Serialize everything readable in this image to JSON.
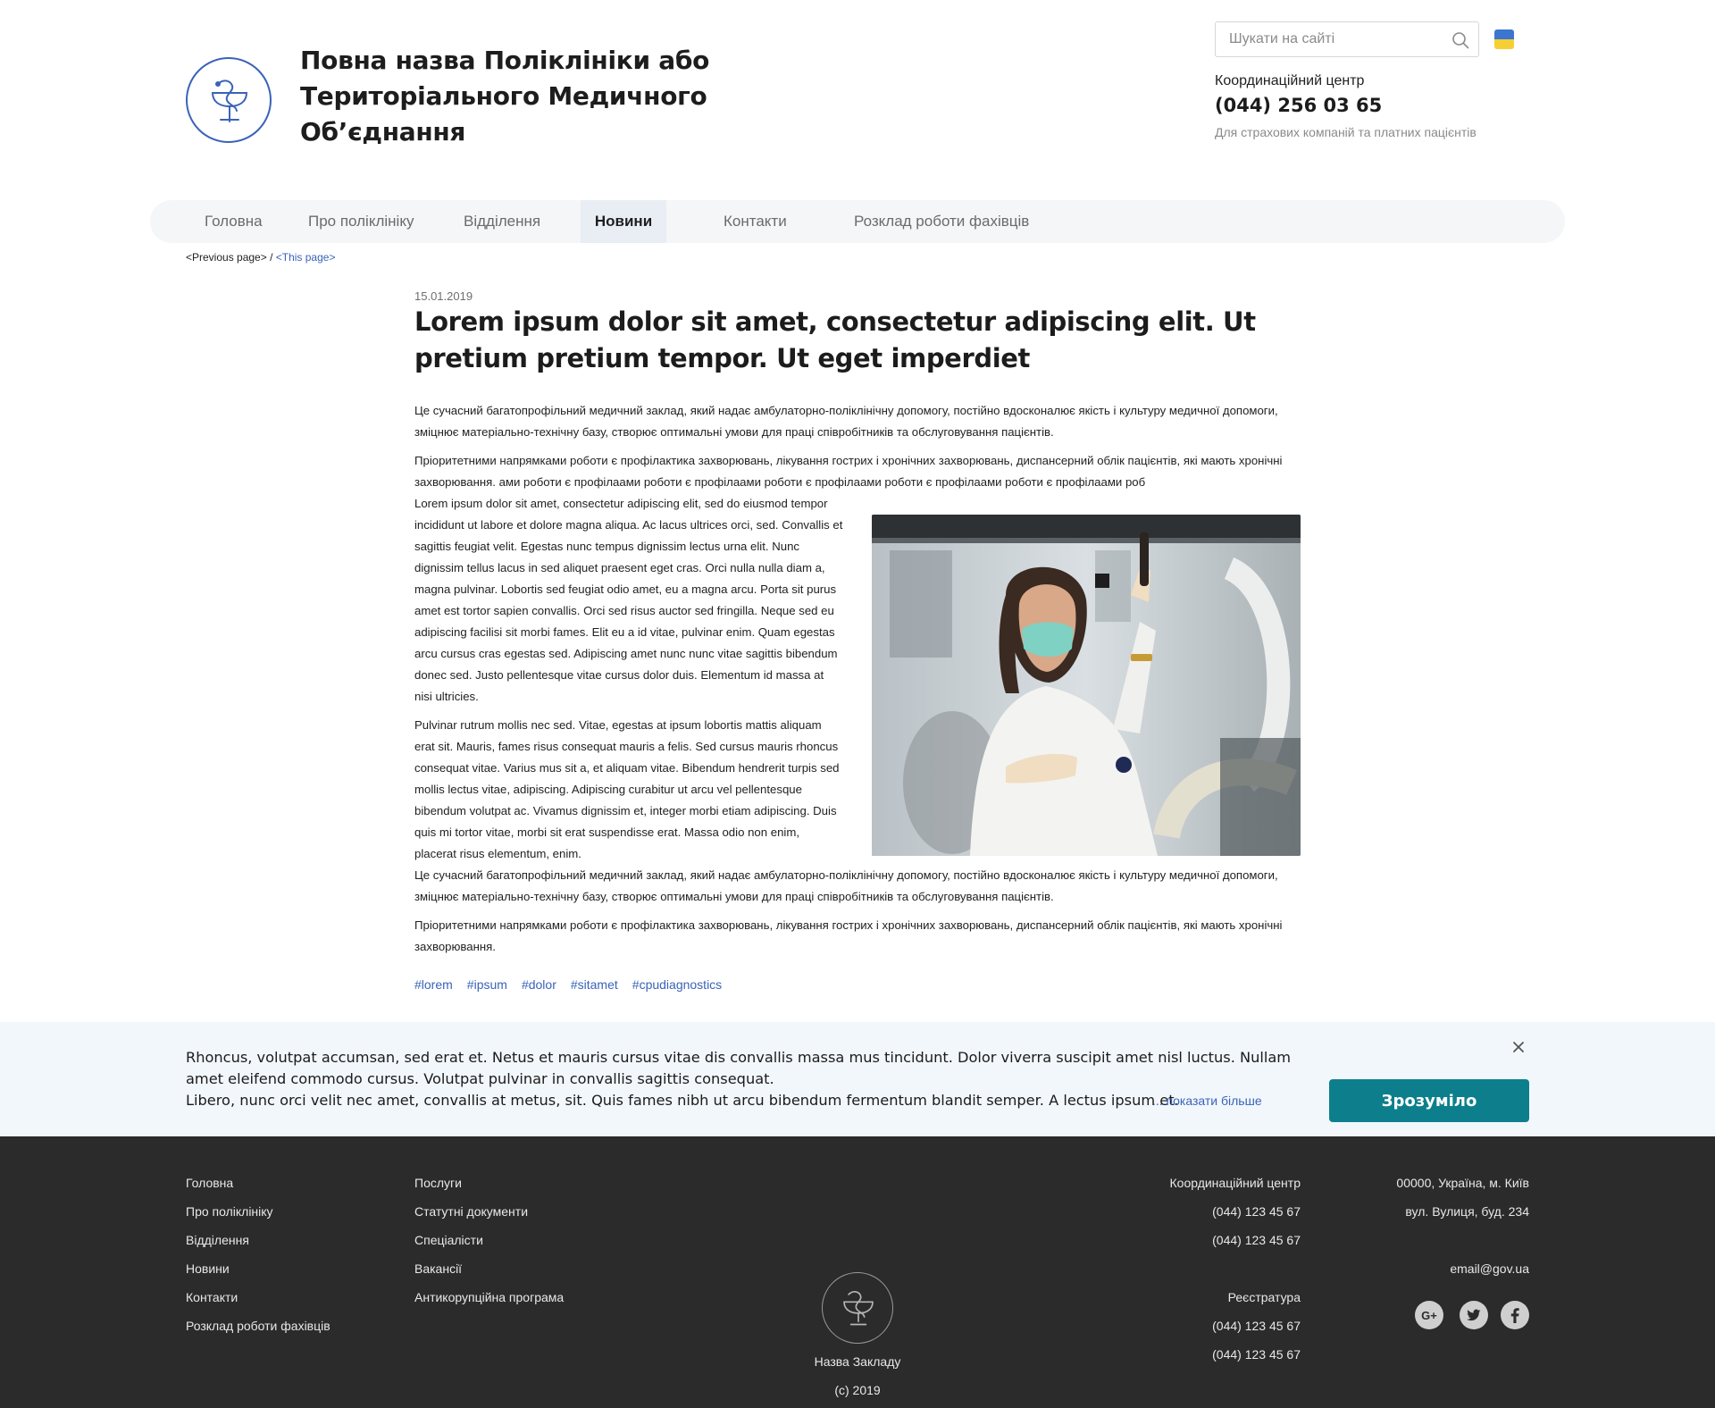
{
  "header": {
    "title": "Повна назва Поліклініки або Територіального Медичного Об’єднання",
    "search_placeholder": "Шукати на сайті",
    "coord_label": "Координаційний центр",
    "coord_phone": "(044) 256 03 65",
    "coord_note": "Для страхових компаній та платних пацієнтів"
  },
  "nav": {
    "items": [
      {
        "label": "Головна"
      },
      {
        "label": "Про поліклініку"
      },
      {
        "label": "Відділення"
      },
      {
        "label": "Новини",
        "active": true
      },
      {
        "label": "Контакти"
      },
      {
        "label": "Розклад роботи фахівців"
      }
    ]
  },
  "breadcrumb": {
    "previous": "<Previous page>",
    "separator": " / ",
    "current": "<This page>"
  },
  "article": {
    "date": "15.01.2019",
    "title": "Lorem ipsum dolor sit amet, consectetur adipiscing elit. Ut pretium pretium tempor. Ut eget imperdiet",
    "p1": "Це сучасний багатопрофільний медичний заклад, який надає амбулаторно-поліклінічну допомогу, постійно вдосконалює якість і культуру медичної допомоги, зміцнює матеріально-технічну базу, створює оптимальні умови для праці співробітників та обслуговування пацієнтів.",
    "p2": "Пріоритетними напрямками роботи є профілактика захворювань, лікування гострих і хронічних захворювань, диспансерний облік пацієнтів, які мають хронічні захворювання. ами роботи є профілаами роботи є профілаами роботи є профілаами роботи є профілаами роботи є профілаами роб",
    "col1": "Lorem ipsum dolor sit amet, consectetur adipiscing elit, sed do eiusmod tempor incididunt ut labore et dolore magna aliqua. Ac lacus ultrices orci, sed. Convallis et sagittis feugiat velit. Egestas nunc tempus dignissim lectus urna elit. Nunc dignissim tellus lacus in sed aliquet praesent eget cras. Orci nulla nulla diam a, magna pulvinar. Lobortis sed feugiat odio amet, eu a magna arcu. Porta sit purus amet est tortor sapien convallis. Orci sed risus auctor sed fringilla. Neque sed eu adipiscing facilisi sit morbi fames. Elit eu a id vitae, pulvinar enim. Quam egestas arcu cursus cras egestas sed. Adipiscing amet nunc nunc vitae sagittis bibendum donec sed. Justo pellentesque vitae cursus dolor duis. Elementum id massa at nisi ultricies.",
    "col2": "Pulvinar rutrum mollis nec sed. Vitae, egestas at ipsum lobortis mattis aliquam erat sit. Mauris, fames risus consequat mauris a felis. Sed cursus mauris rhoncus consequat vitae. Varius mus sit a, et aliquam vitae. Bibendum hendrerit turpis sed mollis lectus vitae, adipiscing. Adipiscing curabitur ut arcu vel pellentesque bibendum volutpat ac. Vivamus dignissim et, integer morbi etiam adipiscing. Duis quis mi tortor vitae, morbi sit erat suspendisse erat. Massa odio non enim, placerat risus elementum, enim.",
    "p3": "Це сучасний багатопрофільний медичний заклад, який надає амбулаторно-поліклінічну допомогу, постійно вдосконалює якість і культуру медичної допомоги, зміцнює матеріально-технічну базу, створює оптимальні умови для праці співробітників та обслуговування пацієнтів.",
    "p4": "Пріоритетними напрямками роботи є профілактика захворювань, лікування гострих і хронічних захворювань, диспансерний облік пацієнтів, які мають хронічні захворювання.",
    "tags": [
      "#lorem",
      "#ipsum",
      "#dolor",
      "#sitamet",
      "#cpudiagnostics"
    ]
  },
  "cookie_banner": {
    "text_line1": "Rhoncus, volutpat accumsan, sed erat et. Netus et mauris cursus vitae dis convallis massa mus tincidunt. Dolor viverra suscipit amet nisl luctus. Nullam amet eleifend commodo cursus. Volutpat pulvinar in convallis sagittis consequat.",
    "text_line2": "Libero, nunc orci velit nec amet, convallis at metus, sit. Quis fames nibh ut arcu bibendum fermentum blandit semper. A lectus ipsum et.",
    "show_more": "... показати більше",
    "accept": "Зрозуміло"
  },
  "footer": {
    "col1": [
      "Головна",
      "Про поліклініку",
      "Відділення",
      "Новини",
      "Контакти",
      "Розклад роботи фахівців"
    ],
    "col2": [
      "Послуги",
      "Статутні документи",
      "Спеціалісти",
      "Вакансії",
      "Антикорупційна програма"
    ],
    "coord_title": "Координаційний центр",
    "coord_phones": [
      "(044) 123 45 67",
      "(044) 123 45 67"
    ],
    "reg_title": "Реєстратура",
    "reg_phones": [
      "(044) 123 45 67",
      "(044) 123 45 67"
    ],
    "address1": "00000, Україна, м. Київ",
    "address2": "вул. Вулиця, буд. 234",
    "email": "email@gov.ua",
    "org_name": "Назва Закладу",
    "copyright": "(c) 2019",
    "social": [
      "google-plus-icon",
      "twitter-icon",
      "facebook-icon"
    ]
  },
  "colors": {
    "accent": "#3a63b8",
    "button": "#0d7f8c",
    "footer_bg": "#2b2b2b",
    "banner_bg": "#f2f7fc",
    "nav_bg": "#f5f6f7"
  }
}
